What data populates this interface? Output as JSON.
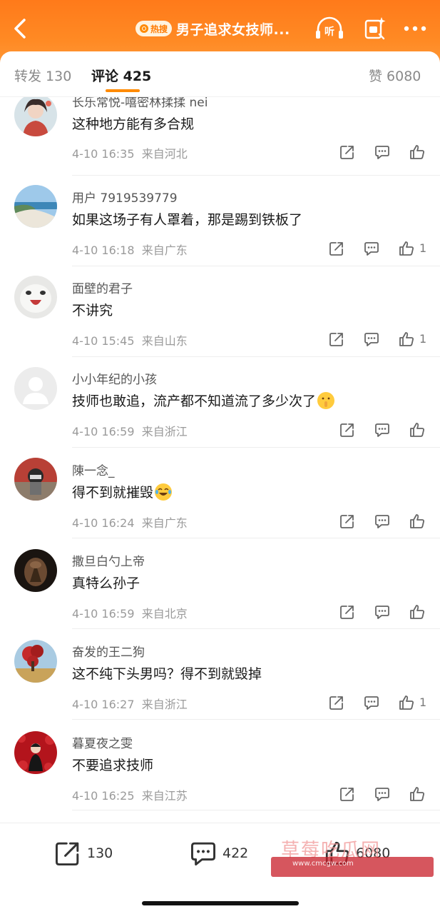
{
  "header": {
    "hot_tag": "热搜",
    "title": "男子追求女技师...",
    "listen_label": "听"
  },
  "tabs": {
    "repost": "转发 130",
    "comments": "评论 425",
    "likes": "赞 6080"
  },
  "comments": [
    {
      "username": "长乐常悦-嘻密林揉揉 nei",
      "text": "这种地方能有多合规",
      "time": "4-10 16:35",
      "location": "来自河北",
      "likes": ""
    },
    {
      "username": "用户 7919539779",
      "text": "如果这场子有人罩着，那是踢到铁板了",
      "time": "4-10 16:18",
      "location": "来自广东",
      "likes": "1"
    },
    {
      "username": "面壁的君子",
      "text": "不讲究",
      "time": "4-10 15:45",
      "location": "来自山东",
      "likes": "1"
    },
    {
      "username": "小小年纪的小孩",
      "text": "技师也敢追，流产都不知道流了多少次了",
      "time": "4-10 16:59",
      "location": "来自浙江",
      "likes": ""
    },
    {
      "username": "陳一念_",
      "text": "得不到就摧毁",
      "time": "4-10 16:24",
      "location": "来自广东",
      "likes": ""
    },
    {
      "username": "撒旦白勺上帝",
      "text": "真特么孙子",
      "time": "4-10 16:59",
      "location": "来自北京",
      "likes": ""
    },
    {
      "username": "奋发的王二狗",
      "text": "这不纯下头男吗？得不到就毁掉",
      "time": "4-10 16:27",
      "location": "来自浙江",
      "likes": "1"
    },
    {
      "username": "暮夏夜之雯",
      "text": "不要追求技师",
      "time": "4-10 16:25",
      "location": "来自江苏",
      "likes": ""
    }
  ],
  "bottom_bar": {
    "repost_count": "130",
    "comment_count": "422",
    "like_count": "6080"
  },
  "watermark": {
    "top": "草莓吃瓜网",
    "sub": "www.cmcgw.com"
  },
  "colors": {
    "brand_orange": "#ff7a1a",
    "tab_underline": "#ff8a00"
  }
}
